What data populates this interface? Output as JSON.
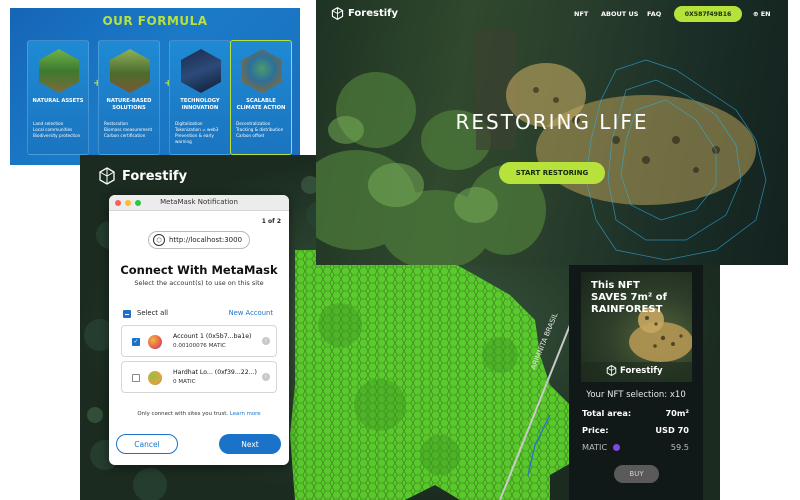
{
  "formula": {
    "title": "OUR FORMULA",
    "cards": [
      {
        "title": "NATURAL ASSETS",
        "items": [
          "Land selection",
          "Local communities",
          "Biodiversity protection"
        ]
      },
      {
        "title": "NATURE-BASED SOLUTIONS",
        "items": [
          "Restoration",
          "Biomass measurement",
          "Carbon certification"
        ]
      },
      {
        "title": "TECHNOLOGY INNOVATION",
        "items": [
          "Digitalization",
          "Tokenization = web3",
          "Prevention & early warning"
        ]
      },
      {
        "title": "SCALABLE CLIMATE ACTION",
        "items": [
          "Decentralization",
          "Tracking & distribution",
          "Carbon offset"
        ]
      }
    ],
    "operators": [
      "+",
      "+",
      "="
    ]
  },
  "hero": {
    "brand": "Forestify",
    "nav": [
      "NFT",
      "ABOUT US",
      "FAQ"
    ],
    "phone": "0X587f49B16",
    "lang": "EN",
    "headline": "RESTORING LIFE",
    "cta": "START RESTORING"
  },
  "map": {
    "brand": "Forestify",
    "road_label": "ARIMNITA BRASIL"
  },
  "metamask": {
    "window_title": "MetaMask Notification",
    "page_count": "1 of 2",
    "host": "http://localhost:3000",
    "heading": "Connect With MetaMask",
    "subheading": "Select the account(s) to use on this site",
    "select_all": "Select all",
    "new_account": "New Account",
    "accounts": [
      {
        "name": "Account 1 (0x5b7...ba1e)",
        "balance": "0.00100076 MATIC",
        "checked": true
      },
      {
        "name": "Hardhat Lo... (0xf39...22...)",
        "balance": "0 MATIC",
        "checked": false
      }
    ],
    "trust_note": "Only connect with sites you trust.",
    "learn_more": "Learn more",
    "cancel": "Cancel",
    "next": "Next"
  },
  "nft": {
    "image_text": "This NFT SAVES 7m² of RAINFOREST",
    "image_brand": "Forestify",
    "selection": "Your NFT selection: x10",
    "rows": [
      {
        "label": "Total area:",
        "value": "70m²"
      },
      {
        "label": "Price:",
        "value": "USD 70"
      },
      {
        "label": "MATIC",
        "value": "59.5"
      }
    ],
    "buy": "BUY"
  },
  "colors": {
    "accent_green": "#b6e23b",
    "formula_blue": "#1a6fbd",
    "metamask_blue": "#1a73c9",
    "hex_green": "#5dd62c"
  },
  "icons": [
    "forestify-logo-icon",
    "info-icon",
    "checkbox-icon",
    "matic-icon"
  ]
}
